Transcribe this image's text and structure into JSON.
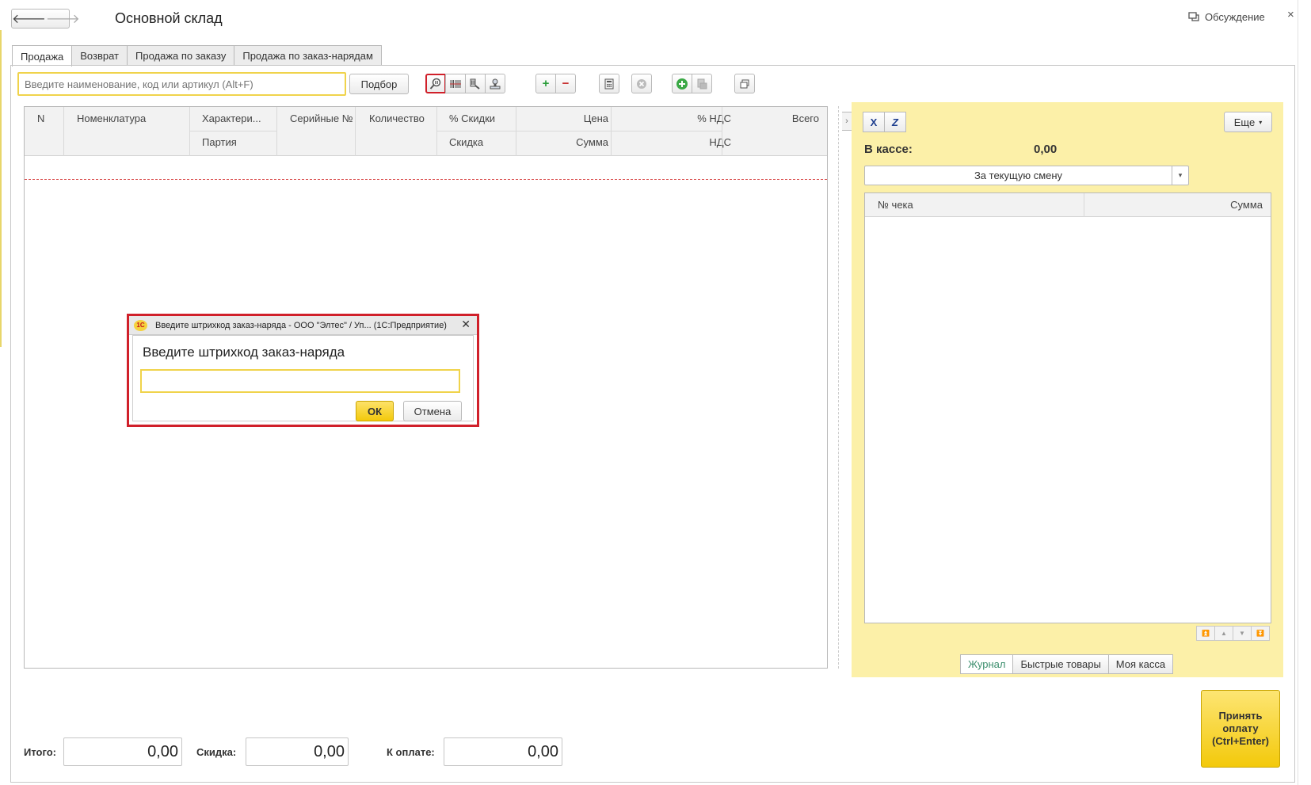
{
  "window": {
    "title": "Основной склад",
    "discussion_label": "Обсуждение",
    "close_glyph": "×"
  },
  "nav": {
    "back_glyph": "🡐",
    "forward_glyph": "🡒"
  },
  "tabs": [
    {
      "label": "Продажа",
      "active": true
    },
    {
      "label": "Возврат"
    },
    {
      "label": "Продажа по заказу"
    },
    {
      "label": "Продажа по заказ-нарядам"
    }
  ],
  "search": {
    "placeholder": "Введите наименование, код или артикул (Alt+F)",
    "value": "",
    "pick_button": "Подбор"
  },
  "toolbar_icons": [
    "barcode-search-icon",
    "barcode-icon",
    "barcode-scanner-icon",
    "stamp-icon",
    "plus-icon",
    "minus-icon",
    "calculator-icon",
    "cancel-icon",
    "add-green-icon",
    "print-icon",
    "window-icon"
  ],
  "table": {
    "headers": {
      "n": "N",
      "nomenclature": "Номенклатура",
      "characteristic": "Характери...",
      "batch": "Партия",
      "serial": "Серийные №",
      "quantity": "Количество",
      "discount_pct": "% Скидки",
      "discount": "Скидка",
      "price": "Цена",
      "sum": "Сумма",
      "vat_pct": "% НДС",
      "vat": "НДС",
      "total": "Всего"
    },
    "rows": []
  },
  "dialog": {
    "title": "Введите штрихкод заказ-наряда - ООО \"Элтес\" / Уп... (1С:Предприятие)",
    "logo_text": "1С",
    "heading": "Введите штрихкод заказ-наряда",
    "input_value": "",
    "ok_label": "ОК",
    "cancel_label": "Отмена",
    "close_glyph": "✕"
  },
  "right_panel": {
    "excel_label": "X",
    "zip_label": "Z",
    "more_label": "Еще",
    "cash_label": "В кассе:",
    "cash_value": "0,00",
    "period_value": "За текущую смену",
    "columns": {
      "receipt_no": "№ чека",
      "sum": "Сумма"
    },
    "rows": [],
    "tabs": [
      {
        "label": "Журнал",
        "active": true
      },
      {
        "label": "Быстрые товары"
      },
      {
        "label": "Моя касса"
      }
    ]
  },
  "totals": {
    "total_label": "Итого:",
    "total_value": "0,00",
    "discount_label": "Скидка:",
    "discount_value": "0,00",
    "pay_label": "К оплате:",
    "pay_value": "0,00"
  },
  "pay_button": {
    "line1": "Принять",
    "line2": "оплату",
    "line3": "(Ctrl+Enter)"
  }
}
